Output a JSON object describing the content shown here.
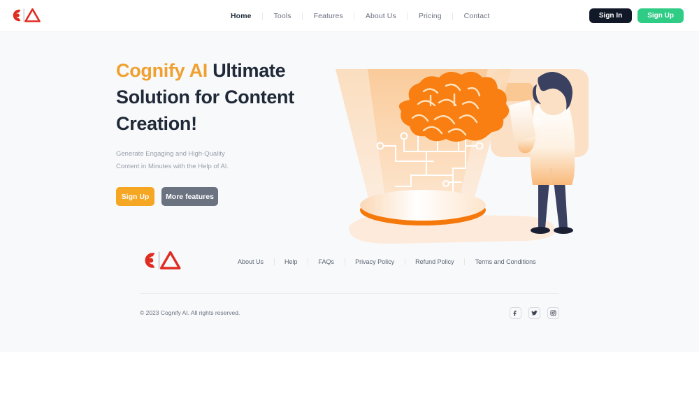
{
  "brand": {
    "name": "Cognify AI",
    "logo_icon": "cognify-c-triangle-logo",
    "logo_color": "#e02b20"
  },
  "colors": {
    "accent_orange": "#f5a623",
    "brand_amber": "#f0a030",
    "signin_dark": "#111827",
    "signup_green": "#2ecc84",
    "more_features_gray": "#6b7280",
    "page_bg": "#f8f9fb",
    "heading": "#1f2937"
  },
  "header": {
    "nav": [
      {
        "label": "Home",
        "active": true
      },
      {
        "label": "Tools",
        "active": false
      },
      {
        "label": "Features",
        "active": false
      },
      {
        "label": "About Us",
        "active": false
      },
      {
        "label": "Pricing",
        "active": false
      },
      {
        "label": "Contact",
        "active": false
      }
    ],
    "sign_in_label": "Sign In",
    "sign_up_label": "Sign Up"
  },
  "hero": {
    "title_brand": "Cognify AI",
    "title_rest": " Ultimate Solution for Content Creation!",
    "subtitle": "Generate Engaging and High-Quality Content in Minutes with the Help of AI.",
    "primary_button": "Sign Up",
    "secondary_button": "More features",
    "illustration": "ai-brain-hologram-with-scientist"
  },
  "footer": {
    "logo_icon": "cognify-c-triangle-logo",
    "links": [
      {
        "label": "About Us"
      },
      {
        "label": "Help"
      },
      {
        "label": "FAQs"
      },
      {
        "label": "Privacy Policy"
      },
      {
        "label": "Refund Policy"
      },
      {
        "label": "Terms and Conditions"
      }
    ],
    "copyright": "© 2023 Cognify AI. All rights reserved.",
    "socials": [
      {
        "name": "facebook-icon"
      },
      {
        "name": "twitter-icon"
      },
      {
        "name": "instagram-icon"
      }
    ]
  }
}
